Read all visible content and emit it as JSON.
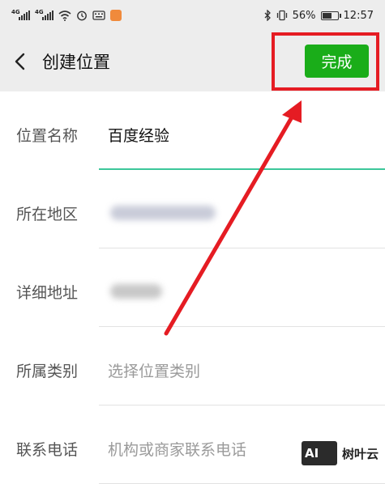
{
  "status_bar": {
    "signal_1": "4G",
    "signal_2": "4G",
    "battery": "56%",
    "time": "12:57"
  },
  "header": {
    "title": "创建位置",
    "done_label": "完成"
  },
  "form": {
    "rows": [
      {
        "label": "位置名称",
        "value": "百度经验"
      },
      {
        "label": "所在地区"
      },
      {
        "label": "详细地址"
      },
      {
        "label": "所属类别",
        "placeholder": "选择位置类别"
      },
      {
        "label": "联系电话",
        "placeholder": "机构或商家联系电话"
      }
    ]
  },
  "watermark": {
    "logo": "AI",
    "text": "树叶云"
  },
  "colors": {
    "accent_green": "#1aad19",
    "focus_line": "#3cc79a",
    "annotation_red": "#e51c23",
    "header_bg": "#ededed"
  },
  "icons": [
    "back-arrow-icon",
    "wifi-icon",
    "alarm-icon",
    "keyboard-icon",
    "bluetooth-icon",
    "vibrate-icon",
    "battery-icon"
  ]
}
